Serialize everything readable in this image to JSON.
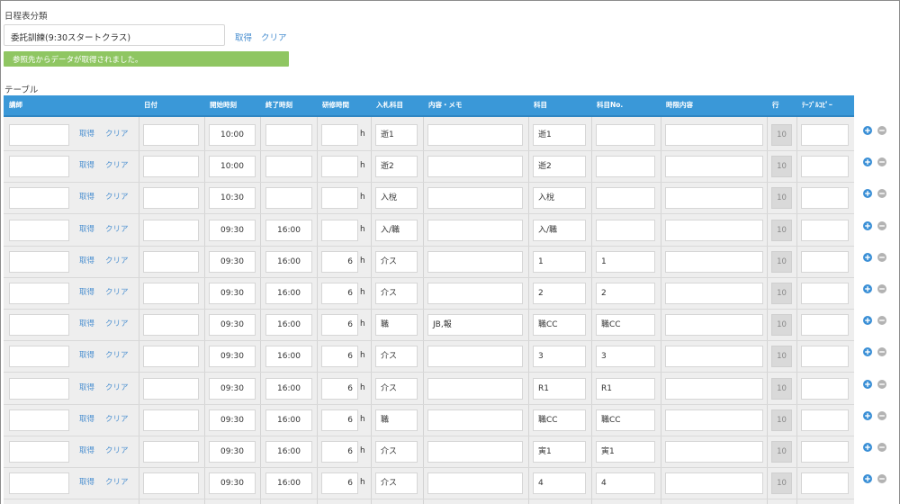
{
  "category": {
    "label": "日程表分類",
    "value": "委託訓練(9:30スタートクラス)",
    "get_label": "取得",
    "clear_label": "クリア"
  },
  "message": "参照先からデータが取得されました。",
  "table": {
    "label": "テーブル",
    "headers": {
      "instructor": "講師",
      "date": "日付",
      "start_time": "開始時刻",
      "end_time": "終了時刻",
      "training_hours": "研修時間",
      "bid_subject": "入札科目",
      "memo": "内容・メモ",
      "subject": "科目",
      "subject_no": "科目No.",
      "period_content": "時限内容",
      "row": "行",
      "table_copy": "ﾃｰﾌﾞﾙｺﾋﾟｰ"
    },
    "row_get_label": "取得",
    "row_clear_label": "クリア",
    "hour_unit": "h",
    "rows": [
      {
        "start": "10:00",
        "end": "",
        "hours": "",
        "bid": "逝1",
        "memo": "",
        "subject": "逝1",
        "subject_no": "",
        "row_no": "10"
      },
      {
        "start": "10:00",
        "end": "",
        "hours": "",
        "bid": "逝2",
        "memo": "",
        "subject": "逝2",
        "subject_no": "",
        "row_no": "10"
      },
      {
        "start": "10:30",
        "end": "",
        "hours": "",
        "bid": "入梲",
        "memo": "",
        "subject": "入梲",
        "subject_no": "",
        "row_no": "10"
      },
      {
        "start": "09:30",
        "end": "16:00",
        "hours": "",
        "bid": "入/職",
        "memo": "",
        "subject": "入/職",
        "subject_no": "",
        "row_no": "10"
      },
      {
        "start": "09:30",
        "end": "16:00",
        "hours": "6",
        "bid": "介ス",
        "memo": "",
        "subject": "1",
        "subject_no": "1",
        "row_no": "10"
      },
      {
        "start": "09:30",
        "end": "16:00",
        "hours": "6",
        "bid": "介ス",
        "memo": "",
        "subject": "2",
        "subject_no": "2",
        "row_no": "10"
      },
      {
        "start": "09:30",
        "end": "16:00",
        "hours": "6",
        "bid": "職",
        "memo": "JB,報",
        "subject": "職CC",
        "subject_no": "職CC",
        "row_no": "10"
      },
      {
        "start": "09:30",
        "end": "16:00",
        "hours": "6",
        "bid": "介ス",
        "memo": "",
        "subject": "3",
        "subject_no": "3",
        "row_no": "10"
      },
      {
        "start": "09:30",
        "end": "16:00",
        "hours": "6",
        "bid": "介ス",
        "memo": "",
        "subject": "R1",
        "subject_no": "R1",
        "row_no": "10"
      },
      {
        "start": "09:30",
        "end": "16:00",
        "hours": "6",
        "bid": "職",
        "memo": "",
        "subject": "職CC",
        "subject_no": "職CC",
        "row_no": "10"
      },
      {
        "start": "09:30",
        "end": "16:00",
        "hours": "6",
        "bid": "介ス",
        "memo": "",
        "subject": "寅1",
        "subject_no": "寅1",
        "row_no": "10"
      },
      {
        "start": "09:30",
        "end": "16:00",
        "hours": "6",
        "bid": "介ス",
        "memo": "",
        "subject": "4",
        "subject_no": "4",
        "row_no": "10"
      }
    ]
  },
  "colors": {
    "header_bg": "#3a98d8",
    "link": "#4a8fd0",
    "success_bg": "#8fc662",
    "add_icon": "#3a8fd6",
    "remove_icon": "#b3b3b3"
  },
  "icons": {
    "add": "plus-circle-icon",
    "remove": "minus-circle-icon"
  }
}
